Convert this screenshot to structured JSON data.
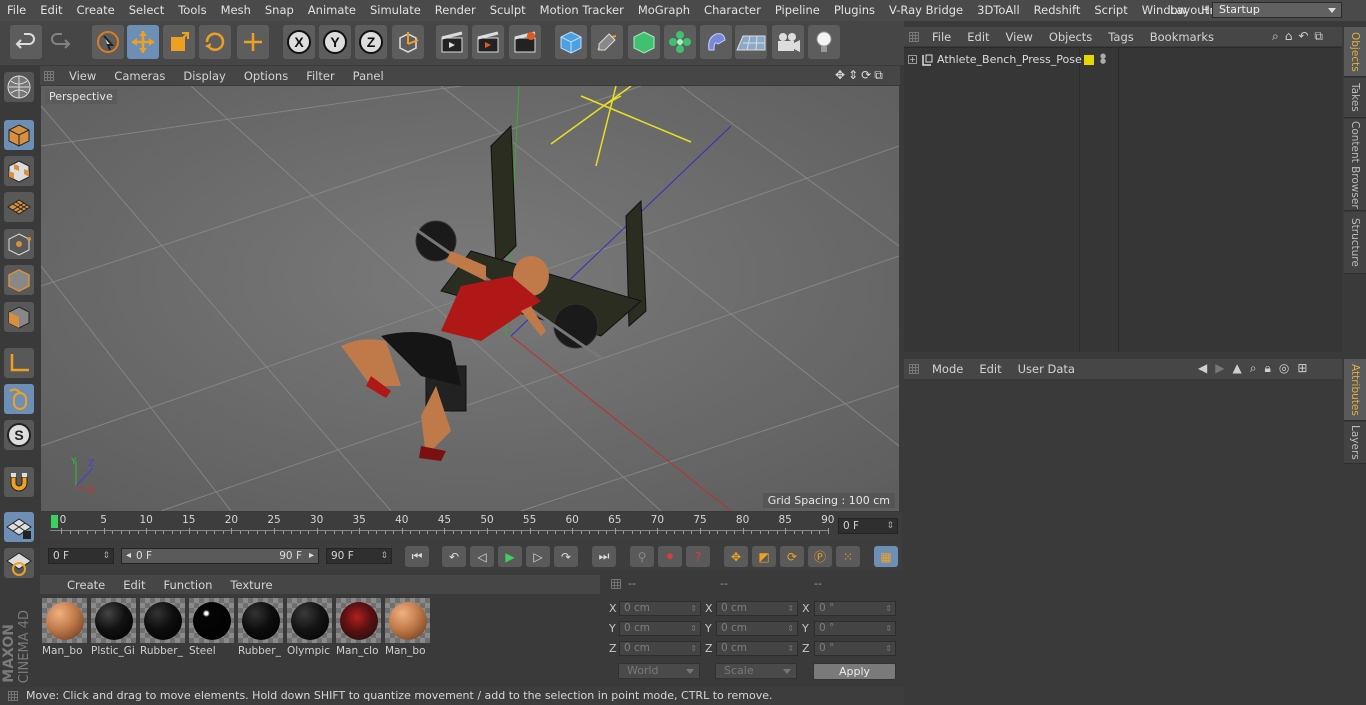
{
  "menu": [
    "File",
    "Edit",
    "Create",
    "Select",
    "Tools",
    "Mesh",
    "Snap",
    "Animate",
    "Simulate",
    "Render",
    "Sculpt",
    "Motion Tracker",
    "MoGraph",
    "Character",
    "Pipeline",
    "Plugins",
    "V-Ray Bridge",
    "3DToAll",
    "Redshift",
    "Script",
    "Window",
    "Help"
  ],
  "layout": {
    "label": "Layout:",
    "value": "Startup"
  },
  "viewport": {
    "menu": [
      "View",
      "Cameras",
      "Display",
      "Options",
      "Filter",
      "Panel"
    ],
    "camera_label": "Perspective",
    "grid_spacing": "Grid Spacing : 100 cm"
  },
  "timeline": {
    "ticks": [
      "0",
      "5",
      "10",
      "15",
      "20",
      "25",
      "30",
      "35",
      "40",
      "45",
      "50",
      "55",
      "60",
      "65",
      "70",
      "75",
      "80",
      "85",
      "90"
    ],
    "current_frame_field": "0 F"
  },
  "transport": {
    "start_field": "0 F",
    "range_start": "0 F",
    "range_end": "90 F",
    "end_field": "90 F"
  },
  "materials": {
    "menu": [
      "Create",
      "Edit",
      "Function",
      "Texture"
    ],
    "items": [
      {
        "name": "Man_bo",
        "color": "#c07a4a"
      },
      {
        "name": "Plstic_Gi",
        "color": "#111111"
      },
      {
        "name": "Rubber_",
        "color": "#0d0d0d"
      },
      {
        "name": "Steel",
        "color": "#050505"
      },
      {
        "name": "Rubber_",
        "color": "#0d0d0d"
      },
      {
        "name": "Olympic",
        "color": "#141414"
      },
      {
        "name": "Man_clo",
        "color": "#5a1010"
      },
      {
        "name": "Man_bo",
        "color": "#c07a4a"
      }
    ]
  },
  "coords": {
    "headers": [
      "--",
      "--",
      "--"
    ],
    "rows": [
      {
        "a": "X",
        "pos": "0 cm",
        "b": "X",
        "size": "0 cm",
        "c": "X",
        "rot": "0 °"
      },
      {
        "a": "Y",
        "pos": "0 cm",
        "b": "Y",
        "size": "0 cm",
        "c": "Y",
        "rot": "0 °"
      },
      {
        "a": "Z",
        "pos": "0 cm",
        "b": "Z",
        "size": "0 cm",
        "c": "Z",
        "rot": "0 °"
      }
    ],
    "mode": "World",
    "transform": "Scale",
    "apply": "Apply"
  },
  "status": "Move: Click and drag to move elements. Hold down SHIFT to quantize movement / add to the selection in point mode, CTRL to remove.",
  "objects": {
    "menu": [
      "File",
      "Edit",
      "View",
      "Objects",
      "Tags",
      "Bookmarks"
    ],
    "tree": [
      {
        "name": "Athlete_Bench_Press_Pose",
        "icon": "null-object-icon"
      }
    ]
  },
  "attributes": {
    "menu": [
      "Mode",
      "Edit",
      "User Data"
    ]
  },
  "right_tabs": [
    "Objects",
    "Takes",
    "Content Browser",
    "Structure",
    "Attributes",
    "Layers"
  ],
  "brand": {
    "line1": "MAXON",
    "line2": "CINEMA 4D"
  },
  "colors": {
    "accent": "#6e8fb5",
    "selection": "#e0b040",
    "layer_yellow": "#e8d600"
  }
}
